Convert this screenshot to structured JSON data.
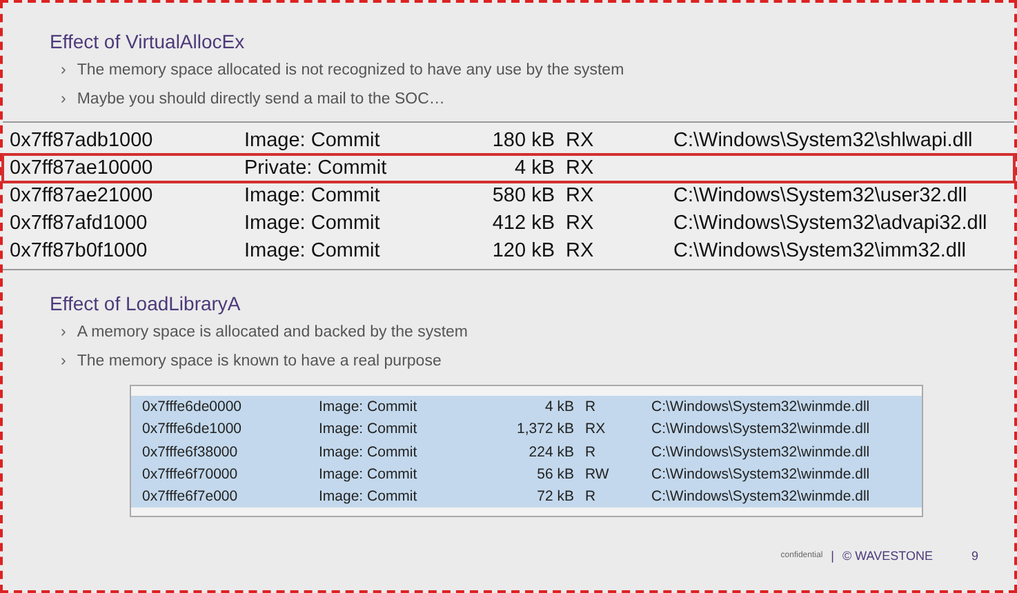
{
  "sections": [
    {
      "title": "Effect of VirtualAllocEx",
      "bullet_marker": "›",
      "bullets": [
        "The memory space allocated is not recognized to have any use by the system",
        "Maybe you should directly send a mail to the SOC…"
      ],
      "table": {
        "kind": "large",
        "rows": [
          {
            "address": "0x7ff87adb1000",
            "type": "Image: Commit",
            "size": "180 kB",
            "protection": "RX",
            "path": "C:\\Windows\\System32\\shlwapi.dll"
          },
          {
            "address": "0x7ff87ae10000",
            "type": "Private: Commit",
            "size": "4 kB",
            "protection": "RX",
            "highlighted": true
          },
          {
            "address": "0x7ff87ae21000",
            "type": "Image: Commit",
            "size": "580 kB",
            "protection": "RX",
            "path": "C:\\Windows\\System32\\user32.dll"
          },
          {
            "address": "0x7ff87afd1000",
            "type": "Image: Commit",
            "size": "412 kB",
            "protection": "RX",
            "path": "C:\\Windows\\System32\\advapi32.dll"
          },
          {
            "address": "0x7ff87b0f1000",
            "type": "Image: Commit",
            "size": "120 kB",
            "protection": "RX",
            "path": "C:\\Windows\\System32\\imm32.dll"
          }
        ]
      }
    },
    {
      "title": "Effect of LoadLibraryA",
      "bullet_marker": "›",
      "bullets": [
        "A memory space is allocated and backed by the system",
        "The memory space is known to have a real purpose"
      ],
      "table": {
        "kind": "small",
        "rows": [
          {
            "address": "0x7fffe6de0000",
            "type": "Image: Commit",
            "size": "4 kB",
            "protection": "R",
            "path": "C:\\Windows\\System32\\winmde.dll",
            "selected": true
          },
          {
            "address": "0x7fffe6de1000",
            "type": "Image: Commit",
            "size": "1,372 kB",
            "protection": "RX",
            "path": "C:\\Windows\\System32\\winmde.dll",
            "selected": true
          },
          {
            "address": "0x7fffe6f38000",
            "type": "Image: Commit",
            "size": "224 kB",
            "protection": "R",
            "path": "C:\\Windows\\System32\\winmde.dll",
            "selected": true
          },
          {
            "address": "0x7fffe6f70000",
            "type": "Image: Commit",
            "size": "56 kB",
            "protection": "RW",
            "path": "C:\\Windows\\System32\\winmde.dll",
            "selected": true
          },
          {
            "address": "0x7fffe6f7e000",
            "type": "Image: Commit",
            "size": "72 kB",
            "protection": "R",
            "path": "C:\\Windows\\System32\\winmde.dll",
            "selected": true
          }
        ]
      }
    }
  ],
  "footer": {
    "label": "confidential",
    "separator": "|",
    "brand": "© WAVESTONE",
    "page_number": "9"
  }
}
